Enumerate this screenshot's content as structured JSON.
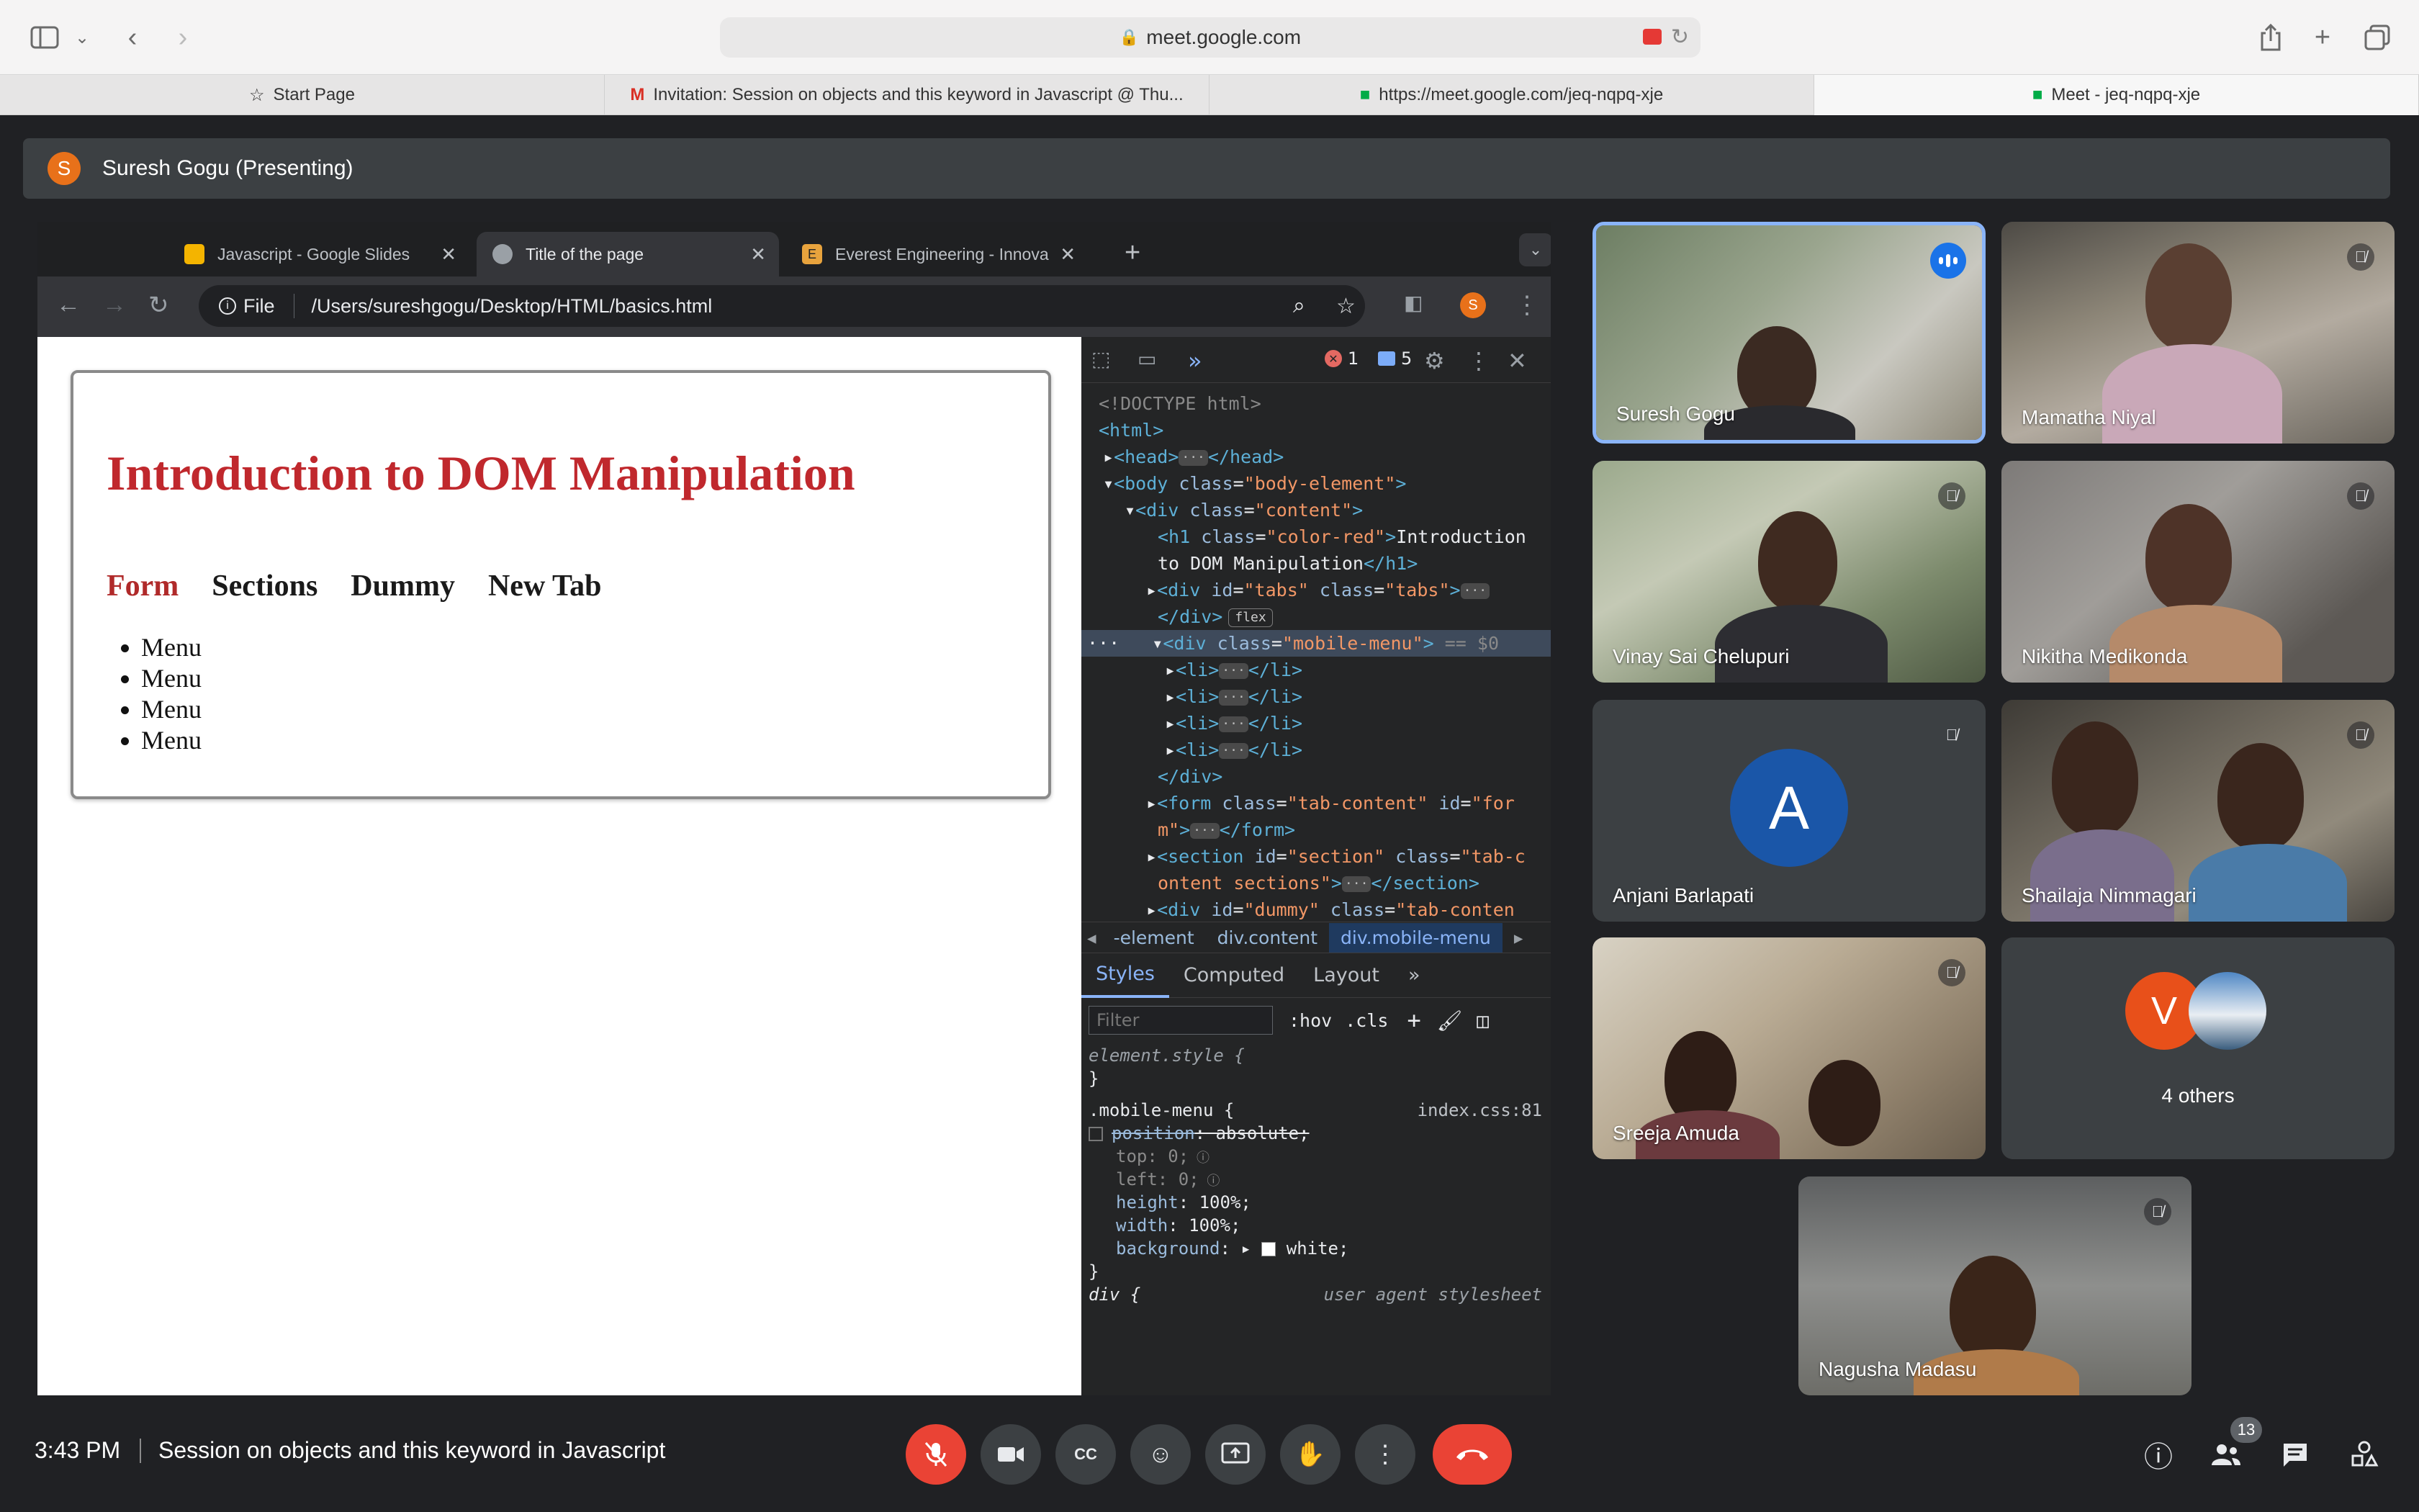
{
  "browser": {
    "address": "meet.google.com",
    "tabs": [
      {
        "label": "Start Page",
        "icon": "star-icon"
      },
      {
        "label": "Invitation: Session on objects and this keyword in Javascript @ Thu...",
        "icon": "gmail-icon"
      },
      {
        "label": "https://meet.google.com/jeq-nqpq-xje",
        "icon": "meet-icon"
      },
      {
        "label": "Meet - jeq-nqpq-xje",
        "icon": "meet-icon"
      }
    ]
  },
  "presenter": {
    "initial": "S",
    "name": "Suresh Gogu (Presenting)"
  },
  "shared_screen": {
    "chrome_tabs": [
      {
        "label": "Javascript - Google Slides",
        "favicon_color": "#f4b400"
      },
      {
        "label": "Title of the page",
        "favicon_color": "#9aa0a6"
      },
      {
        "label": "Everest Engineering - Innova",
        "favicon_color": "#e8a33d",
        "favicon_letter": "E"
      }
    ],
    "omnibox": {
      "scheme": "File",
      "path": "/Users/sureshgogu/Desktop/HTML/basics.html"
    },
    "profile_initial": "S",
    "page": {
      "heading": "Introduction to DOM Manipulation",
      "tabs": [
        "Form",
        "Sections",
        "Dummy",
        "New Tab"
      ],
      "menu_items": [
        "Menu",
        "Menu",
        "Menu",
        "Menu"
      ]
    },
    "devtools": {
      "error_count": "1",
      "issue_count": "5",
      "crumbs": [
        "-element",
        "div.content",
        "div.mobile-menu"
      ],
      "style_tabs": [
        "Styles",
        "Computed",
        "Layout"
      ],
      "filter_placeholder": "Filter",
      "hov": ":hov",
      "cls": ".cls",
      "element_style": "element.style {",
      "rule_selector": ".mobile-menu {",
      "rule_source": "index.css:81",
      "ua_selector": "div {",
      "ua_source": "user agent stylesheet"
    }
  },
  "participants": [
    {
      "name": "Suresh Gogu",
      "speaking": true
    },
    {
      "name": "Mamatha Niyal",
      "muted": true
    },
    {
      "name": "Vinay Sai Chelupuri",
      "muted": true
    },
    {
      "name": "Nikitha Medikonda",
      "muted": true
    },
    {
      "name": "Anjani Barlapati",
      "muted": true,
      "initial": "A",
      "avatar_color": "#1a56a8"
    },
    {
      "name": "Shailaja Nimmagari",
      "muted": true
    },
    {
      "name": "Sreeja Amuda",
      "muted": true
    },
    {
      "name": "Nagusha Madasu",
      "muted": true
    }
  ],
  "others": {
    "label": "4 others",
    "initial": "V",
    "avatar_color": "#e8501a"
  },
  "bottom_bar": {
    "time": "3:43 PM",
    "meeting_title": "Session on objects and this keyword in Javascript",
    "people_count": "13"
  }
}
